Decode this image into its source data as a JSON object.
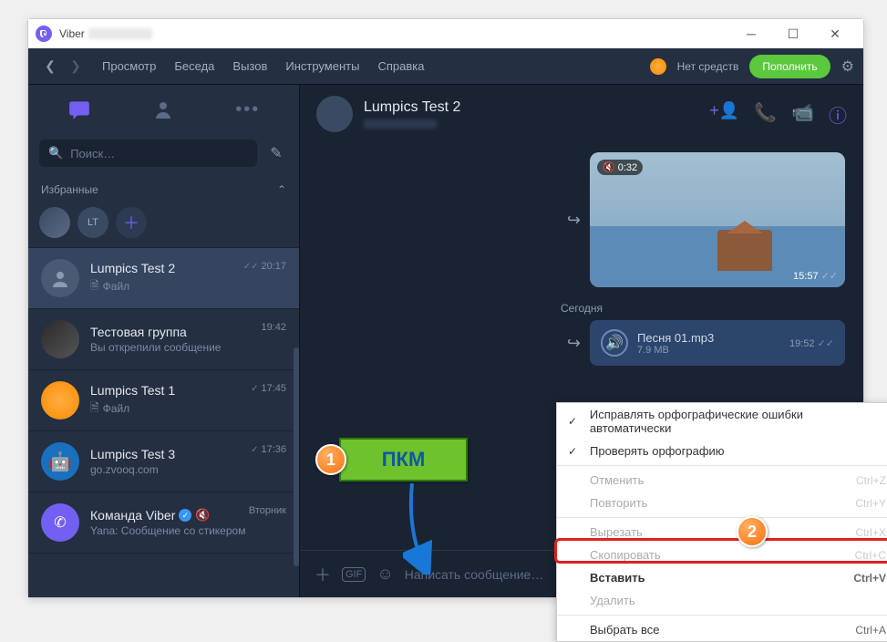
{
  "titlebar": {
    "app": "Viber"
  },
  "menu": {
    "items": [
      "Просмотр",
      "Беседа",
      "Вызов",
      "Инструменты",
      "Справка"
    ],
    "balance": "Нет средств",
    "topup": "Пополнить"
  },
  "search": {
    "placeholder": "Поиск…"
  },
  "favorites": {
    "header": "Избранные",
    "initials": "LT"
  },
  "chats": [
    {
      "name": "Lumpics Test 2",
      "sub": "Файл",
      "time": "20:17",
      "checks": true,
      "file": true
    },
    {
      "name": "Тестовая группа",
      "sub": "Вы открепили сообщение",
      "time": "19:42"
    },
    {
      "name": "Lumpics Test 1",
      "sub": "Файл",
      "time": "17:45",
      "checks": true,
      "file": true
    },
    {
      "name": "Lumpics Test 3",
      "sub": "go.zvooq.com",
      "time": "17:36",
      "checks": true
    },
    {
      "name": "Команда Viber",
      "sub": "Yana: Сообщение со стикером",
      "time": "Вторник",
      "verified": true,
      "muted": true
    }
  ],
  "header": {
    "name": "Lumpics Test 2"
  },
  "video": {
    "duration": "0:32",
    "time": "15:57"
  },
  "dateSep": "Сегодня",
  "audio": {
    "name": "Песня 01.mp3",
    "size": "7.9 MB",
    "time": "19:52"
  },
  "composer": {
    "placeholder": "Написать сообщение…"
  },
  "ctx": {
    "spellAuto": "Исправлять орфографические ошибки автоматически",
    "spellCheck": "Проверять орфографию",
    "undo": "Отменить",
    "undoK": "Ctrl+Z",
    "redo": "Повторить",
    "redoK": "Ctrl+Y",
    "cut": "Вырезать",
    "cutK": "Ctrl+X",
    "copy": "Скопировать",
    "copyK": "Ctrl+C",
    "paste": "Вставить",
    "pasteK": "Ctrl+V",
    "delete": "Удалить",
    "selectAll": "Выбрать все",
    "selectAllK": "Ctrl+A"
  },
  "annot": {
    "pkm": "ПКМ",
    "one": "1",
    "two": "2"
  }
}
